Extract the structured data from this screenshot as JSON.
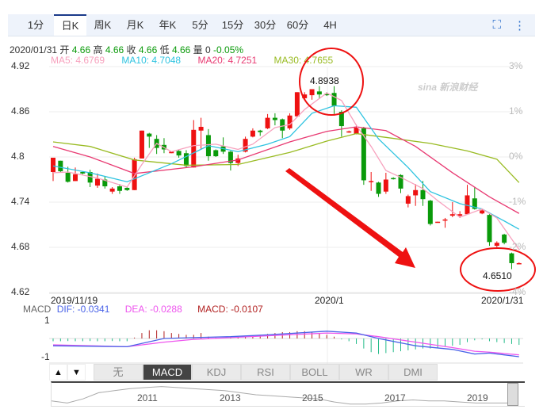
{
  "tabs": [
    "1分",
    "日K",
    "周K",
    "月K",
    "年K",
    "5分",
    "15分",
    "30分",
    "60分",
    "4H"
  ],
  "active_tab": "日K",
  "toolbar": {
    "fullscreen_icon": "⛶",
    "more_icon": "⋮"
  },
  "info": {
    "date": "2020/01/31",
    "open_label": "开",
    "open": "4.66",
    "high_label": "高",
    "high": "4.66",
    "close_label": "收",
    "close": "4.66",
    "low_label": "低",
    "low": "4.66",
    "vol_label": "量",
    "vol": "0",
    "change": "-0.05%"
  },
  "ma": {
    "ma5": "MA5: 4.6769",
    "ma10": "MA10: 4.7048",
    "ma20": "MA20: 4.7251",
    "ma30": "MA30: 4.7655"
  },
  "colors": {
    "up": "#ee1111",
    "down": "#0a9a0a",
    "ma5": "#f7a1bd",
    "ma10": "#2ec3e0",
    "ma20": "#e83a72",
    "ma30": "#99bb22",
    "dif": "#4a63e8",
    "dea": "#ee55ee",
    "macd": "#b22222",
    "annotation": "#ee1111"
  },
  "watermark": "sina 新浪财经",
  "annotations": {
    "high": "4.8938",
    "low": "4.6510"
  },
  "chart_data": {
    "type": "candlestick",
    "y_ticks": [
      "4.92",
      "4.86",
      "4.8",
      "4.74",
      "4.68",
      "4.62"
    ],
    "pct_ticks": [
      "3%",
      "1%",
      "0%",
      "-1%",
      "-2%",
      "-4%"
    ],
    "ylim": [
      4.615,
      4.925
    ],
    "x_labels": {
      "start": "2019/11/19",
      "mid": "2020/1",
      "end": "2020/1/31"
    },
    "ohlc": [
      [
        4.78,
        4.799,
        4.768,
        4.799
      ],
      [
        4.795,
        4.795,
        4.779,
        4.781
      ],
      [
        4.779,
        4.787,
        4.766,
        4.767
      ],
      [
        4.768,
        4.786,
        4.768,
        4.777
      ],
      [
        4.78,
        4.781,
        4.777,
        4.778
      ],
      [
        4.78,
        4.783,
        4.76,
        4.766
      ],
      [
        4.762,
        4.778,
        4.759,
        4.771
      ],
      [
        4.77,
        4.774,
        4.758,
        4.761
      ],
      [
        4.754,
        4.76,
        4.751,
        4.758
      ],
      [
        4.761,
        4.764,
        4.751,
        4.755
      ],
      [
        4.759,
        4.76,
        4.755,
        4.756
      ],
      [
        4.756,
        4.799,
        4.756,
        4.797
      ],
      [
        4.798,
        4.835,
        4.798,
        4.835
      ],
      [
        4.831,
        4.832,
        4.812,
        4.827
      ],
      [
        4.824,
        4.829,
        4.804,
        4.812
      ],
      [
        4.816,
        4.825,
        4.805,
        4.81
      ],
      [
        4.805,
        4.807,
        4.805,
        4.807
      ],
      [
        4.808,
        4.81,
        4.799,
        4.802
      ],
      [
        4.805,
        4.809,
        4.786,
        4.788
      ],
      [
        4.786,
        4.849,
        4.786,
        4.836
      ],
      [
        4.835,
        4.852,
        4.81,
        4.84
      ],
      [
        4.829,
        4.837,
        4.795,
        4.801
      ],
      [
        4.809,
        4.81,
        4.8,
        4.801
      ],
      [
        4.814,
        4.826,
        4.804,
        4.807
      ],
      [
        4.807,
        4.808,
        4.782,
        4.792
      ],
      [
        4.792,
        4.803,
        4.788,
        4.798
      ],
      [
        4.807,
        4.827,
        4.806,
        4.824
      ],
      [
        4.827,
        4.838,
        4.826,
        4.835
      ],
      [
        4.835,
        4.836,
        4.828,
        4.833
      ],
      [
        4.838,
        4.857,
        4.837,
        4.852
      ],
      [
        4.852,
        4.858,
        4.842,
        4.849
      ],
      [
        4.85,
        4.851,
        4.825,
        4.835
      ],
      [
        4.838,
        4.858,
        4.836,
        4.855
      ],
      [
        4.854,
        4.886,
        4.853,
        4.886
      ],
      [
        4.878,
        4.886,
        4.877,
        4.883
      ],
      [
        4.882,
        4.89,
        4.876,
        4.89
      ],
      [
        4.887,
        4.894,
        4.877,
        4.883
      ],
      [
        4.884,
        4.886,
        4.881,
        4.882
      ],
      [
        4.885,
        4.894,
        4.857,
        4.868
      ],
      [
        4.86,
        4.862,
        4.827,
        4.841
      ],
      [
        4.833,
        4.835,
        4.832,
        4.834
      ],
      [
        4.831,
        4.843,
        4.83,
        4.839
      ],
      [
        4.838,
        4.84,
        4.763,
        4.769
      ],
      [
        4.768,
        4.78,
        4.755,
        4.768
      ],
      [
        4.766,
        4.767,
        4.747,
        4.751
      ],
      [
        4.754,
        4.779,
        4.751,
        4.77
      ],
      [
        4.772,
        4.773,
        4.77,
        4.771
      ],
      [
        4.776,
        4.777,
        4.752,
        4.758
      ],
      [
        4.738,
        4.75,
        4.733,
        4.748
      ],
      [
        4.749,
        4.764,
        4.735,
        4.756
      ],
      [
        4.756,
        4.768,
        4.735,
        4.744
      ],
      [
        4.742,
        4.743,
        4.709,
        4.711
      ],
      [
        4.713,
        4.714,
        4.713,
        4.714
      ],
      [
        4.716,
        4.719,
        4.706,
        4.717
      ],
      [
        4.722,
        4.74,
        4.72,
        4.724
      ],
      [
        4.722,
        4.728,
        4.719,
        4.724
      ],
      [
        4.724,
        4.763,
        4.724,
        4.749
      ],
      [
        4.745,
        4.76,
        4.73,
        4.731
      ],
      [
        4.725,
        4.73,
        4.724,
        4.729
      ],
      [
        4.723,
        4.724,
        4.682,
        4.687
      ],
      [
        4.682,
        4.688,
        4.68,
        4.686
      ],
      [
        4.697,
        4.698,
        4.684,
        4.686
      ],
      [
        4.672,
        4.673,
        4.651,
        4.659
      ],
      [
        4.659,
        4.66,
        4.658,
        4.659
      ]
    ],
    "ma_lines": {
      "ma5": [
        [
          1,
          4.779
        ],
        [
          3,
          4.78
        ],
        [
          7,
          4.772
        ],
        [
          11,
          4.76
        ],
        [
          13,
          4.79
        ],
        [
          15,
          4.818
        ],
        [
          17,
          4.807
        ],
        [
          20,
          4.815
        ],
        [
          23,
          4.817
        ],
        [
          26,
          4.81
        ],
        [
          28,
          4.817
        ],
        [
          31,
          4.839
        ],
        [
          33,
          4.843
        ],
        [
          35,
          4.863
        ],
        [
          38,
          4.885
        ],
        [
          40,
          4.875
        ],
        [
          42,
          4.842
        ],
        [
          44,
          4.814
        ],
        [
          46,
          4.782
        ],
        [
          48,
          4.773
        ],
        [
          51,
          4.758
        ],
        [
          53,
          4.742
        ],
        [
          56,
          4.72
        ],
        [
          59,
          4.731
        ],
        [
          61,
          4.719
        ],
        [
          64,
          4.677
        ]
      ],
      "ma10": [
        [
          1,
          4.788
        ],
        [
          6,
          4.779
        ],
        [
          11,
          4.767
        ],
        [
          17,
          4.791
        ],
        [
          22,
          4.815
        ],
        [
          26,
          4.807
        ],
        [
          30,
          4.817
        ],
        [
          33,
          4.827
        ],
        [
          36,
          4.858
        ],
        [
          39,
          4.868
        ],
        [
          42,
          4.866
        ],
        [
          45,
          4.824
        ],
        [
          49,
          4.786
        ],
        [
          52,
          4.754
        ],
        [
          56,
          4.738
        ],
        [
          59,
          4.731
        ],
        [
          62,
          4.715
        ],
        [
          64,
          4.704
        ]
      ],
      "ma20": [
        [
          1,
          4.814
        ],
        [
          6,
          4.8
        ],
        [
          12,
          4.778
        ],
        [
          20,
          4.787
        ],
        [
          26,
          4.796
        ],
        [
          33,
          4.82
        ],
        [
          38,
          4.834
        ],
        [
          42,
          4.84
        ],
        [
          46,
          4.835
        ],
        [
          50,
          4.814
        ],
        [
          55,
          4.779
        ],
        [
          60,
          4.747
        ],
        [
          64,
          4.725
        ]
      ],
      "ma30": [
        [
          1,
          4.82
        ],
        [
          6,
          4.814
        ],
        [
          12,
          4.796
        ],
        [
          19,
          4.789
        ],
        [
          26,
          4.79
        ],
        [
          33,
          4.806
        ],
        [
          38,
          4.821
        ],
        [
          42,
          4.831
        ],
        [
          46,
          4.826
        ],
        [
          52,
          4.818
        ],
        [
          57,
          4.808
        ],
        [
          61,
          4.797
        ],
        [
          64,
          4.766
        ]
      ]
    },
    "macd": {
      "label": "MACD",
      "dif_label": "DIF: -0.0341",
      "dea_label": "DEA: -0.0288",
      "macd_label": "MACD: -0.0107",
      "y_ticks": [
        "1",
        "-1"
      ],
      "ylim": [
        -1,
        1
      ],
      "hist": [
        -0.15,
        -0.15,
        -0.14,
        -0.15,
        -0.15,
        -0.14,
        -0.15,
        -0.15,
        -0.14,
        -0.15,
        -0.15,
        0.05,
        0.3,
        0.45,
        0.45,
        0.4,
        0.3,
        0.25,
        0.2,
        0.2,
        0.3,
        0.1,
        0.05,
        0.03,
        0.02,
        0.05,
        0.1,
        0.15,
        0.2,
        0.25,
        0.3,
        0.35,
        0.35,
        0.4,
        0.4,
        0.35,
        0.3,
        0.2,
        0.1,
        -0.05,
        -0.15,
        -0.3,
        -0.55,
        -0.75,
        -0.85,
        -0.8,
        -0.75,
        -0.7,
        -0.65,
        -0.6,
        -0.55,
        -0.55,
        -0.5,
        -0.45,
        -0.4,
        -0.35,
        -0.2,
        -0.1,
        -0.05,
        -0.15,
        -0.2,
        -0.25,
        -0.3,
        -0.35
      ],
      "dif": [
        [
          1,
          -0.4
        ],
        [
          11,
          -0.45
        ],
        [
          16,
          0
        ],
        [
          20,
          0.05
        ],
        [
          25,
          0.1
        ],
        [
          30,
          0.2
        ],
        [
          36,
          0.35
        ],
        [
          38,
          0.4
        ],
        [
          42,
          0.3
        ],
        [
          45,
          0
        ],
        [
          50,
          -0.4
        ],
        [
          55,
          -0.6
        ],
        [
          58,
          -0.85
        ],
        [
          60,
          -0.8
        ],
        [
          64,
          -1.0
        ]
      ],
      "dea": [
        [
          1,
          -0.35
        ],
        [
          11,
          -0.45
        ],
        [
          16,
          -0.2
        ],
        [
          20,
          -0.05
        ],
        [
          25,
          0.05
        ],
        [
          30,
          0.15
        ],
        [
          38,
          0.3
        ],
        [
          42,
          0.25
        ],
        [
          45,
          0.1
        ],
        [
          50,
          -0.2
        ],
        [
          55,
          -0.5
        ],
        [
          58,
          -0.7
        ],
        [
          60,
          -0.75
        ],
        [
          64,
          -0.9
        ]
      ]
    }
  },
  "indicator_tabs": [
    "无",
    "MACD",
    "KDJ",
    "RSI",
    "BOLL",
    "WR",
    "DMI"
  ],
  "active_indicator": "MACD",
  "scroll": {
    "up": "▲",
    "down": "▼"
  },
  "navigator": {
    "years": [
      "2011",
      "2013",
      "2015",
      "2017",
      "2019"
    ],
    "series": [
      0.2,
      0.1,
      0.3,
      0.6,
      0.7,
      0.8,
      0.85,
      0.9,
      0.85,
      0.8,
      0.75,
      0.7,
      0.6,
      0.5,
      0.45,
      0.4,
      0.35,
      0.3,
      0.15,
      0.05,
      0.05,
      0.1,
      0.2,
      0.25,
      0.2,
      0.2,
      0.15,
      0.1,
      0.1,
      0.1
    ]
  }
}
